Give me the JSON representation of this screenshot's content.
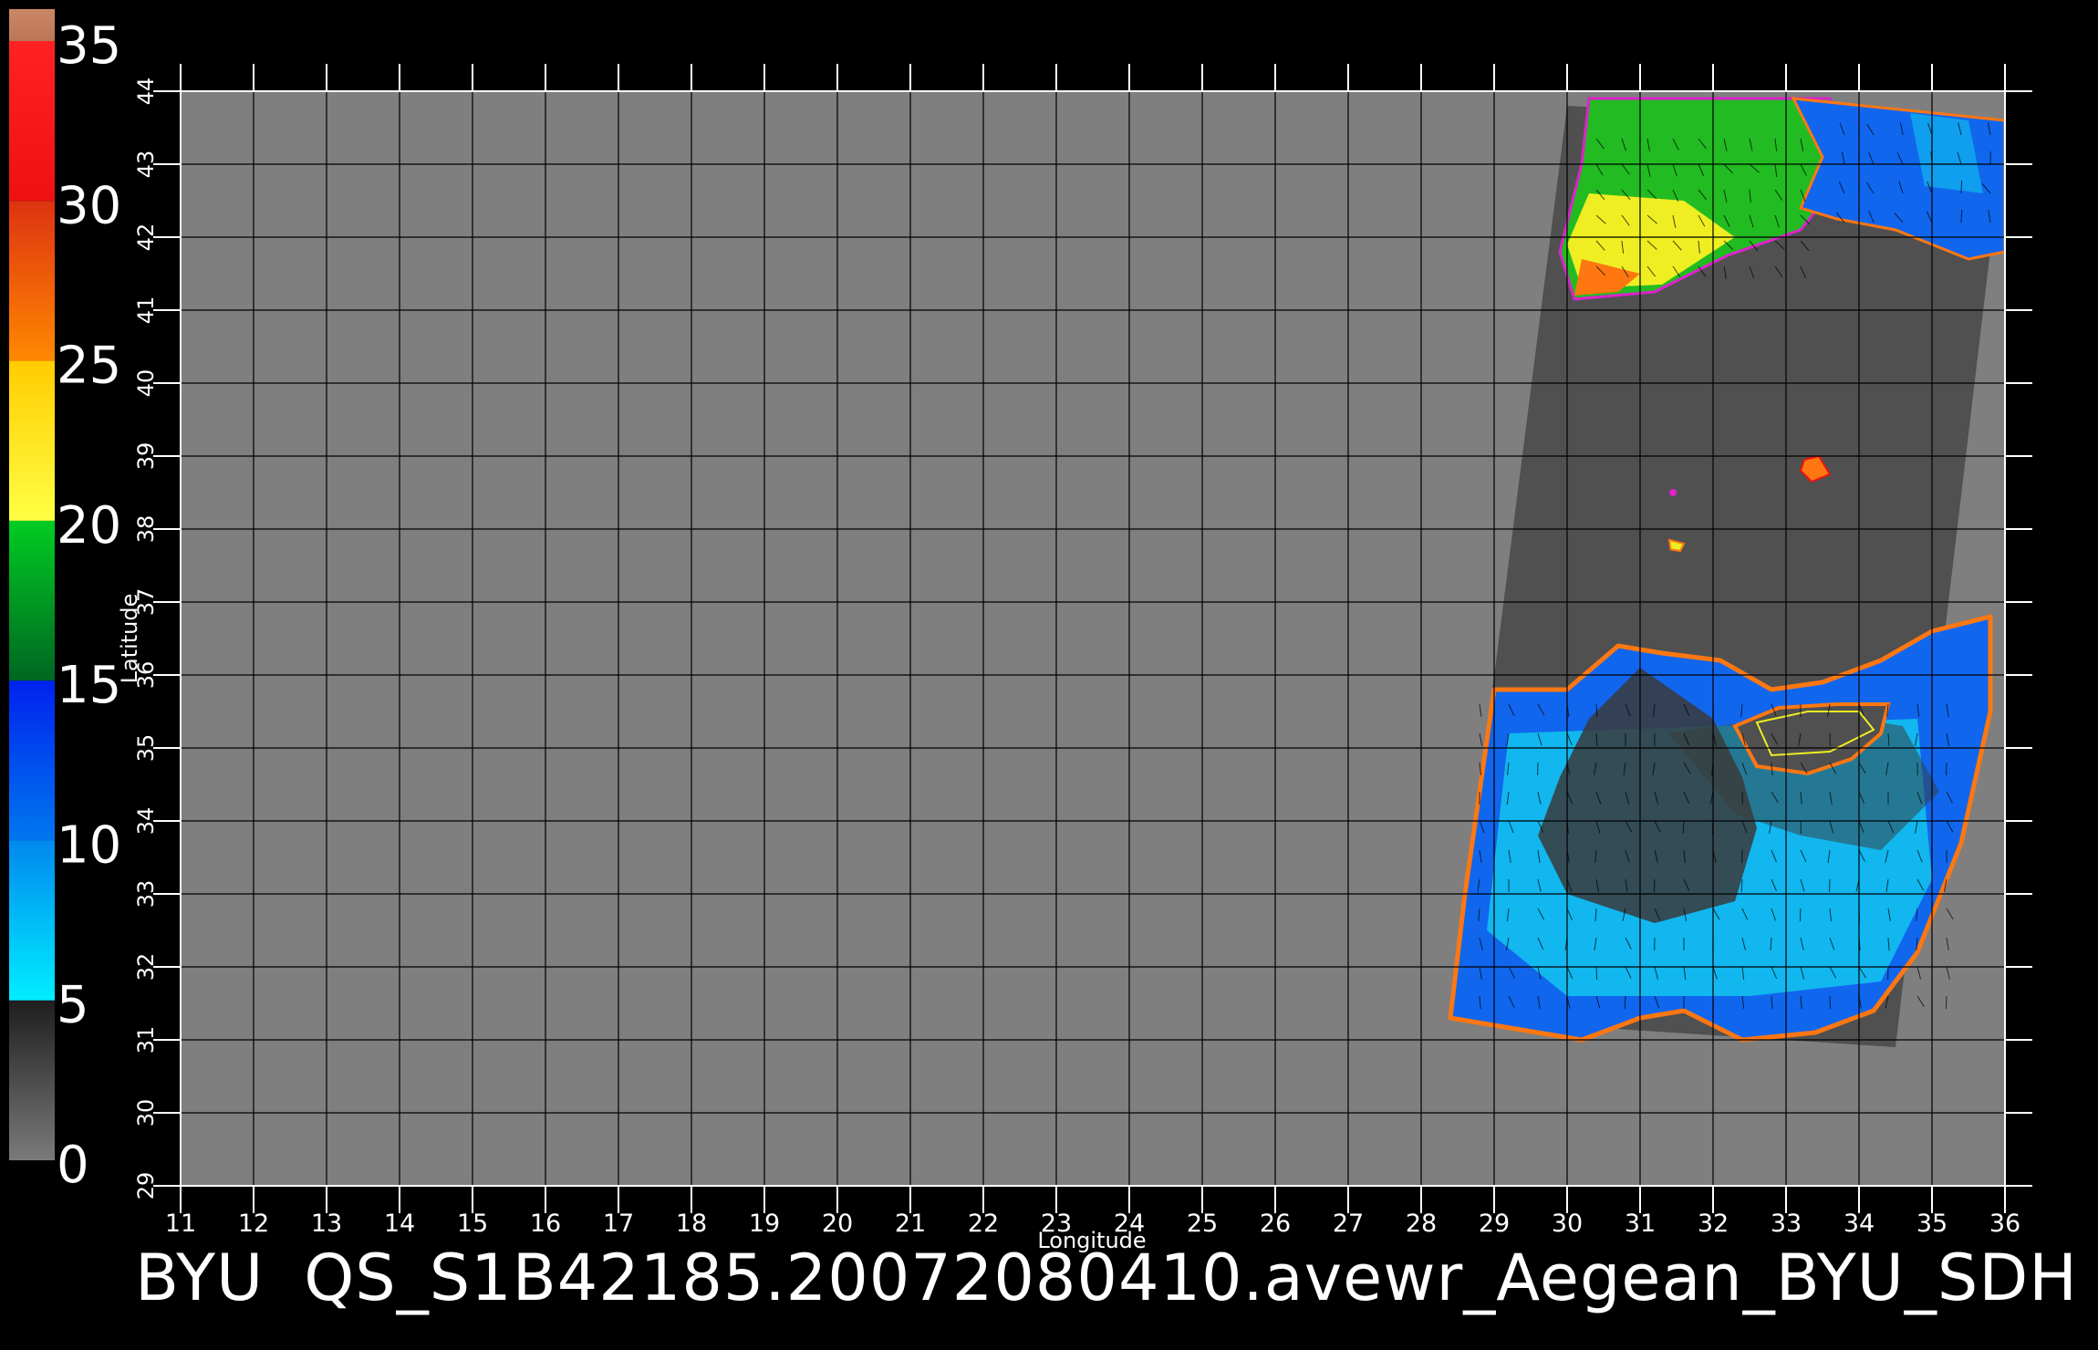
{
  "colorbar": {
    "min": 0,
    "max": 35,
    "ticks": [
      "35",
      "30",
      "25",
      "20",
      "15",
      "10",
      "5",
      "0"
    ],
    "bands": [
      {
        "from": 0,
        "to": 5,
        "color_bottom": "#7a7a7a",
        "color_top": "#1e1e1e"
      },
      {
        "from": 5,
        "to": 10,
        "color_bottom": "#00eeff",
        "color_top": "#0088ee"
      },
      {
        "from": 10,
        "to": 15,
        "color_bottom": "#0077ee",
        "color_top": "#0022ee"
      },
      {
        "from": 15,
        "to": 20,
        "color_bottom": "#006622",
        "color_top": "#00cc22"
      },
      {
        "from": 20,
        "to": 25,
        "color_bottom": "#ffff44",
        "color_top": "#ffcc00"
      },
      {
        "from": 25,
        "to": 30,
        "color_bottom": "#ff8800",
        "color_top": "#dd3311"
      },
      {
        "from": 30,
        "to": 35,
        "color_bottom": "#ee1111",
        "color_top": "#ff2222"
      },
      {
        "from": 35,
        "to": 36,
        "color_bottom": "#bb7755",
        "color_top": "#cc8866"
      }
    ]
  },
  "map": {
    "lon_range": [
      11,
      36
    ],
    "lat_range": [
      29,
      44
    ],
    "lon_ticks": [
      "11",
      "12",
      "13",
      "14",
      "15",
      "16",
      "17",
      "18",
      "19",
      "20",
      "21",
      "22",
      "23",
      "24",
      "25",
      "26",
      "27",
      "28",
      "29",
      "30",
      "31",
      "32",
      "33",
      "34",
      "35",
      "36"
    ],
    "lat_ticks": [
      "29",
      "30",
      "31",
      "32",
      "33",
      "34",
      "35",
      "36",
      "37",
      "38",
      "39",
      "40",
      "41",
      "42",
      "43",
      "44"
    ],
    "xlabel": "Longitude",
    "ylabel": "Latitude",
    "grid": true,
    "background_color": "#7f7f7f",
    "swath_color": "#505050",
    "swath_corners": [
      [
        30.0,
        43.8
      ],
      [
        36.0,
        43.5
      ],
      [
        34.5,
        30.9
      ],
      [
        28.4,
        31.3
      ]
    ],
    "colors": {
      "blue": "#1166ee",
      "cyan": "#11ccee",
      "deep_blue": "#0022dd",
      "green": "#22bb22",
      "yellow": "#eeee22",
      "orange": "#ff7711",
      "red": "#ee1111",
      "magenta": "#dd22cc",
      "dark_land": "#3a3a3a"
    }
  },
  "caption": {
    "source": "BYU",
    "product": "QS_S1B42185.20072080410.avewr_Aegean_BYU_SDH"
  }
}
